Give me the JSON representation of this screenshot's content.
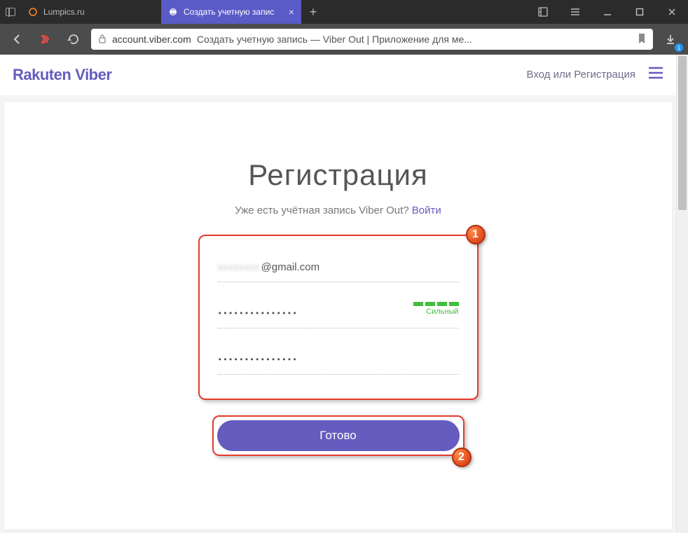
{
  "browser": {
    "tabs": [
      {
        "title": "Lumpics.ru",
        "active": false
      },
      {
        "title": "Создать учетную запис",
        "active": true
      }
    ],
    "address": {
      "domain": "account.viber.com",
      "title": "Создать учетную запись — Viber Out | Приложение для ме..."
    },
    "download_badge": "1"
  },
  "page": {
    "logo_a": "Rakuten",
    "logo_b": "Viber",
    "login_link": "Вход или Регистрация",
    "heading": "Регистрация",
    "sub_text": "Уже есть учётная запись Viber Out? ",
    "sub_link": "Войти",
    "email_blur": "xxxxxxxx",
    "email_suffix": "@gmail.com",
    "password_dots": "•••••••••••••••",
    "password2_dots": "•••••••••••••••",
    "strength_label": "Сильный",
    "submit": "Готово",
    "callout_1": "1",
    "callout_2": "2"
  }
}
